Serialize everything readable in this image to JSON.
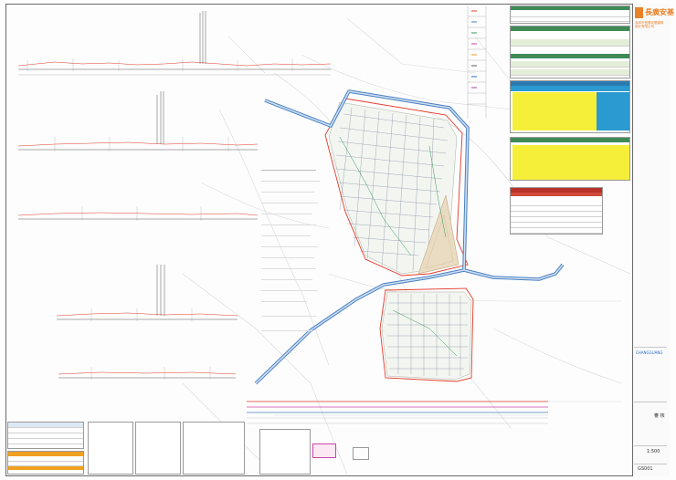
{
  "logo": {
    "text": "長廣安基",
    "subtitle": "深圳市長廣安基建筑設計有限公司"
  },
  "titleblock": {
    "project_line_1": "CHANGGUANG",
    "sign_label": "審 核",
    "drawing_title": "1:500",
    "sheet_no": "GS001"
  },
  "colors": {
    "pipe_blue": "#4a7fc0",
    "boundary_red": "#e23a2a",
    "highlight_yellow": "#f5ef3a",
    "table_green": "#3f8a57",
    "table_red": "#b8322a",
    "logo_orange": "#e8822a"
  }
}
